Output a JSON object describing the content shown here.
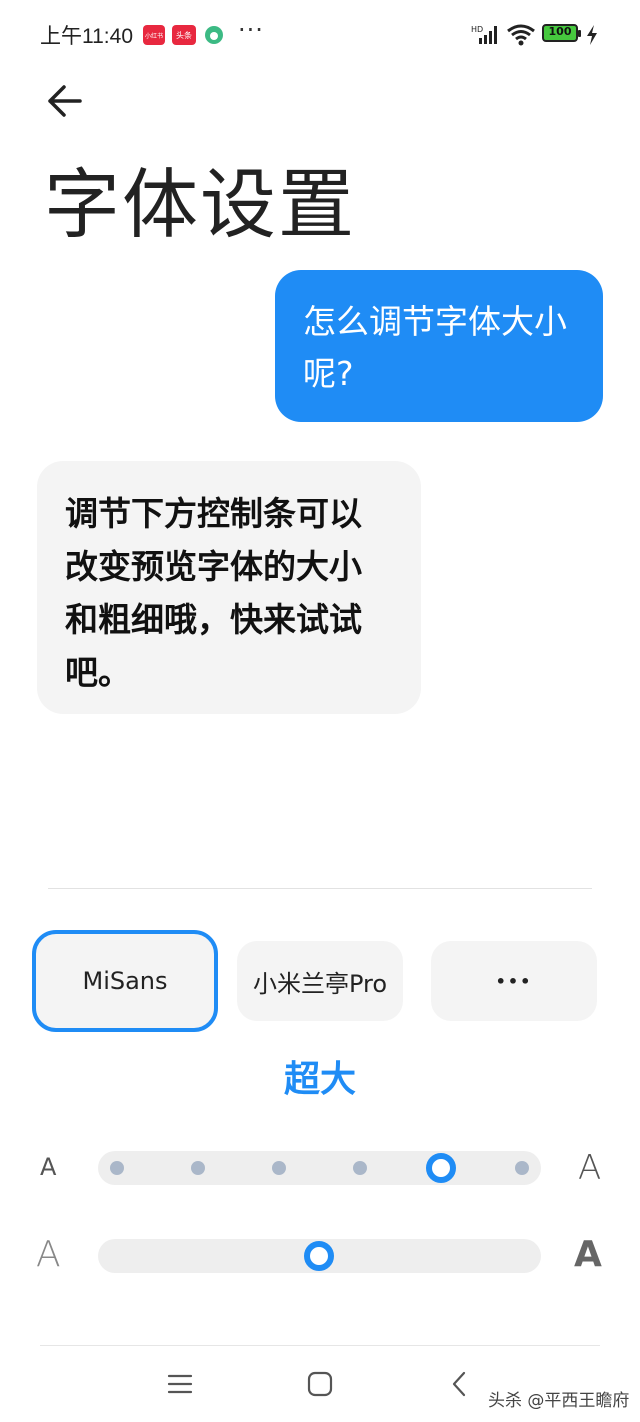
{
  "status_bar": {
    "time": "上午11:40",
    "app_badges": [
      "小红书",
      "头条"
    ],
    "more": "···",
    "network": "HD",
    "battery": "100"
  },
  "page": {
    "title": "字体设置"
  },
  "chat": {
    "question": "怎么调节字体大小呢?",
    "answer": "调节下方控制条可以改变预览字体的大小和粗细哦，快来试试吧。"
  },
  "fonts": {
    "options": [
      "MiSans",
      "小米兰亭Pro",
      "•••"
    ],
    "selected": "MiSans"
  },
  "size": {
    "label": "超大",
    "small_glyph": "A",
    "large_glyph": "A",
    "steps": 6,
    "selected_index": 4
  },
  "weight": {
    "light_glyph": "A",
    "bold_glyph": "A",
    "value_fraction": 0.5
  },
  "nav": {
    "menu": "☰",
    "home": "□",
    "back": "‹"
  },
  "watermark": "头杀 @平西王瞻府",
  "colors": {
    "accent": "#1f8cf5",
    "bubble_bg": "#f4f4f4"
  }
}
